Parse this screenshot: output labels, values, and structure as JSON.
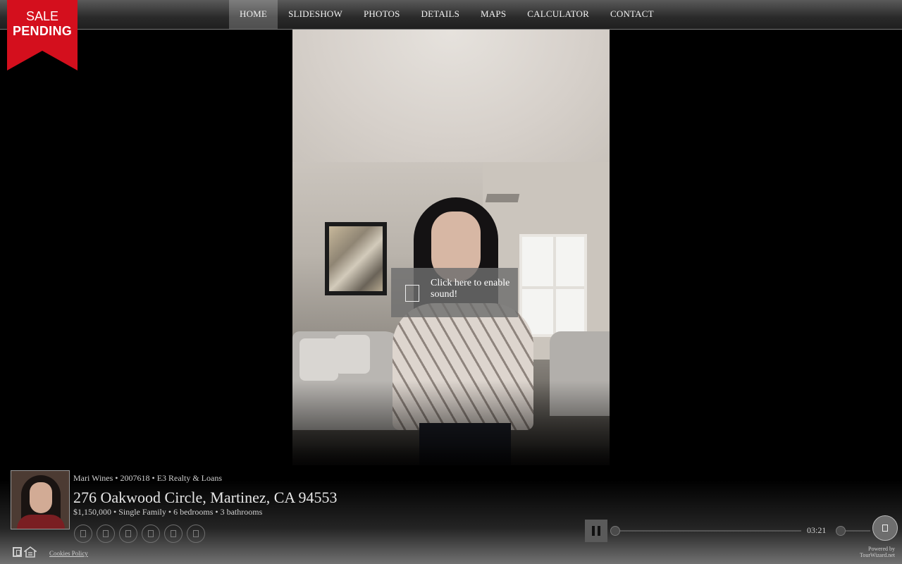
{
  "nav": {
    "items": [
      {
        "label": "HOME",
        "active": true
      },
      {
        "label": "SLIDESHOW"
      },
      {
        "label": "PHOTOS"
      },
      {
        "label": "DETAILS"
      },
      {
        "label": "MAPS"
      },
      {
        "label": "CALCULATOR"
      },
      {
        "label": "CONTACT"
      }
    ]
  },
  "ribbon": {
    "line1": "SALE",
    "line2": "PENDING",
    "color": "#d40f1d"
  },
  "sound_prompt": {
    "text": "Click here to enable sound!",
    "icon": "speaker-icon"
  },
  "listing": {
    "agent_line": "Mari Wines • 2007618 • E3 Realty & Loans",
    "address": "276 Oakwood Circle, Martinez, CA 94553",
    "details": "$1,150,000 • Single Family • 6 bedrooms • 3 bathrooms",
    "social_icons": [
      "facebook-icon",
      "twitter-icon",
      "pinterest-icon",
      "linkedin-icon",
      "email-icon",
      "share-icon"
    ]
  },
  "footer": {
    "cookies_label": "Cookies Policy",
    "powered_by": "Powered by",
    "powered_brand": "TourWizard.net"
  },
  "player": {
    "time": "03:21",
    "progress": 0,
    "volume": 0
  }
}
